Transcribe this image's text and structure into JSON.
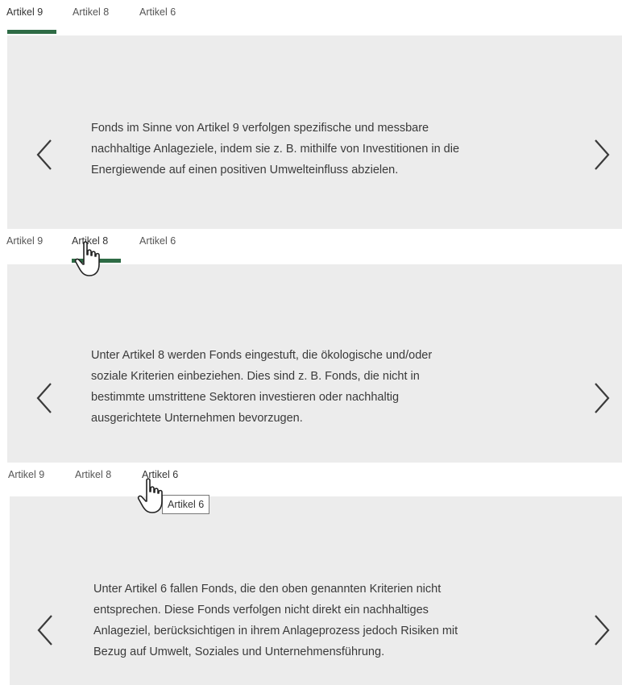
{
  "sections": [
    {
      "tabs": [
        "Artikel 9",
        "Artikel 8",
        "Artikel 6"
      ],
      "active_tab": "Artikel 9",
      "text_lines": [
        "Fonds im Sinne von Artikel 9 verfolgen spezifische und messbare",
        "nachhaltige Anlageziele, indem sie z. B. mithilfe von Investitionen in die",
        "Energiewende auf einen positiven Umwelteinfluss abzielen."
      ]
    },
    {
      "tabs": [
        "Artikel 9",
        "Artikel 8",
        "Artikel 6"
      ],
      "active_tab": "Artikel 8",
      "text_lines": [
        "Unter Artikel 8 werden Fonds eingestuft, die ökologische und/oder",
        "soziale Kriterien einbeziehen. Dies sind z. B. Fonds, die nicht in",
        "bestimmte umstrittene Sektoren investieren oder nachhaltig",
        "ausgerichtete Unternehmen bevorzugen."
      ]
    },
    {
      "tabs": [
        "Artikel 9",
        "Artikel 8",
        "Artikel 6"
      ],
      "active_tab": "Artikel 6",
      "tooltip": "Artikel 6",
      "text_lines": [
        "Unter Artikel 6 fallen Fonds, die den oben genannten Kriterien nicht",
        "entsprechen. Diese Fonds verfolgen nicht direkt ein nachhaltiges",
        "Anlageziel, berücksichtigen in ihrem Anlageprozess jedoch Risiken mit",
        "Bezug auf Umwelt, Soziales und Unternehmensführung."
      ]
    }
  ],
  "icons": {
    "prev": "chevron-left-icon",
    "next": "chevron-right-icon",
    "cursor": "hand-pointer-icon"
  },
  "colors": {
    "accent": "#2e6b45",
    "panel_bg": "#ececec"
  }
}
